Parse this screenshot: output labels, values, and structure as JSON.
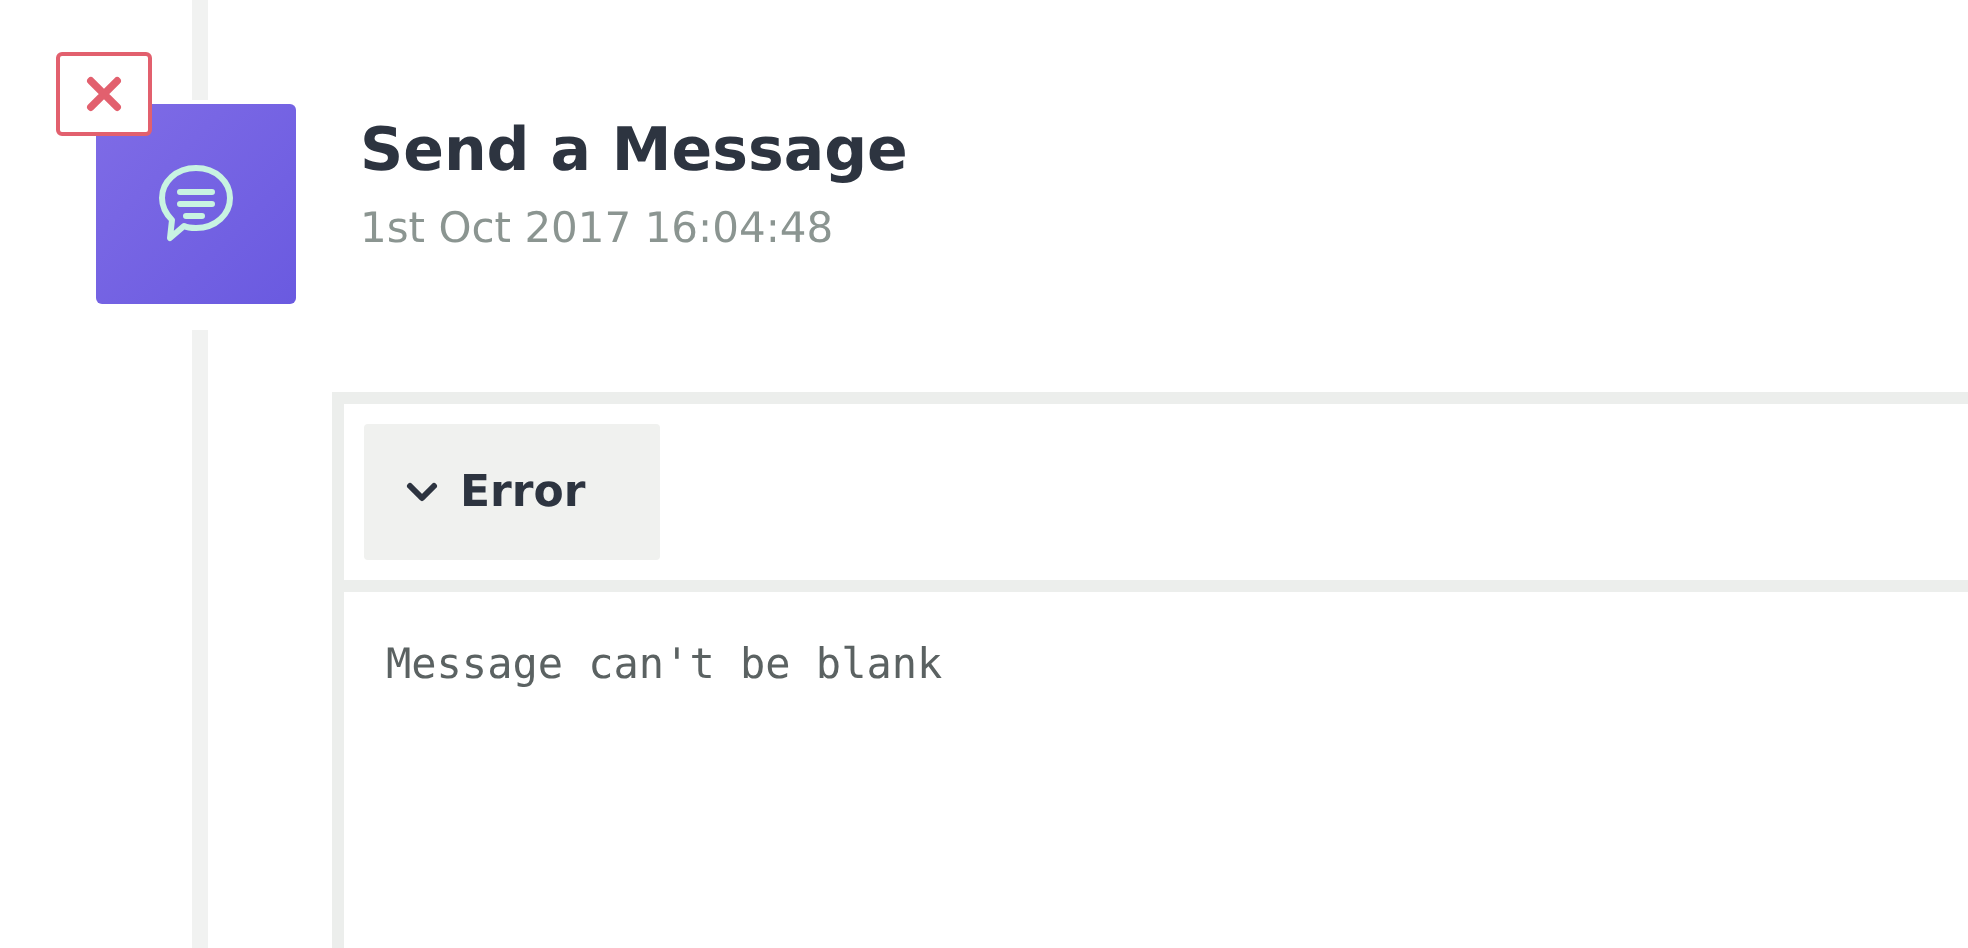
{
  "event": {
    "title": "Send a Message",
    "timestamp": "1st Oct 2017 16:04:48",
    "failed": true
  },
  "error_panel": {
    "toggle": {
      "label": "Error",
      "expanded": true
    },
    "message": "Message can't be blank"
  }
}
